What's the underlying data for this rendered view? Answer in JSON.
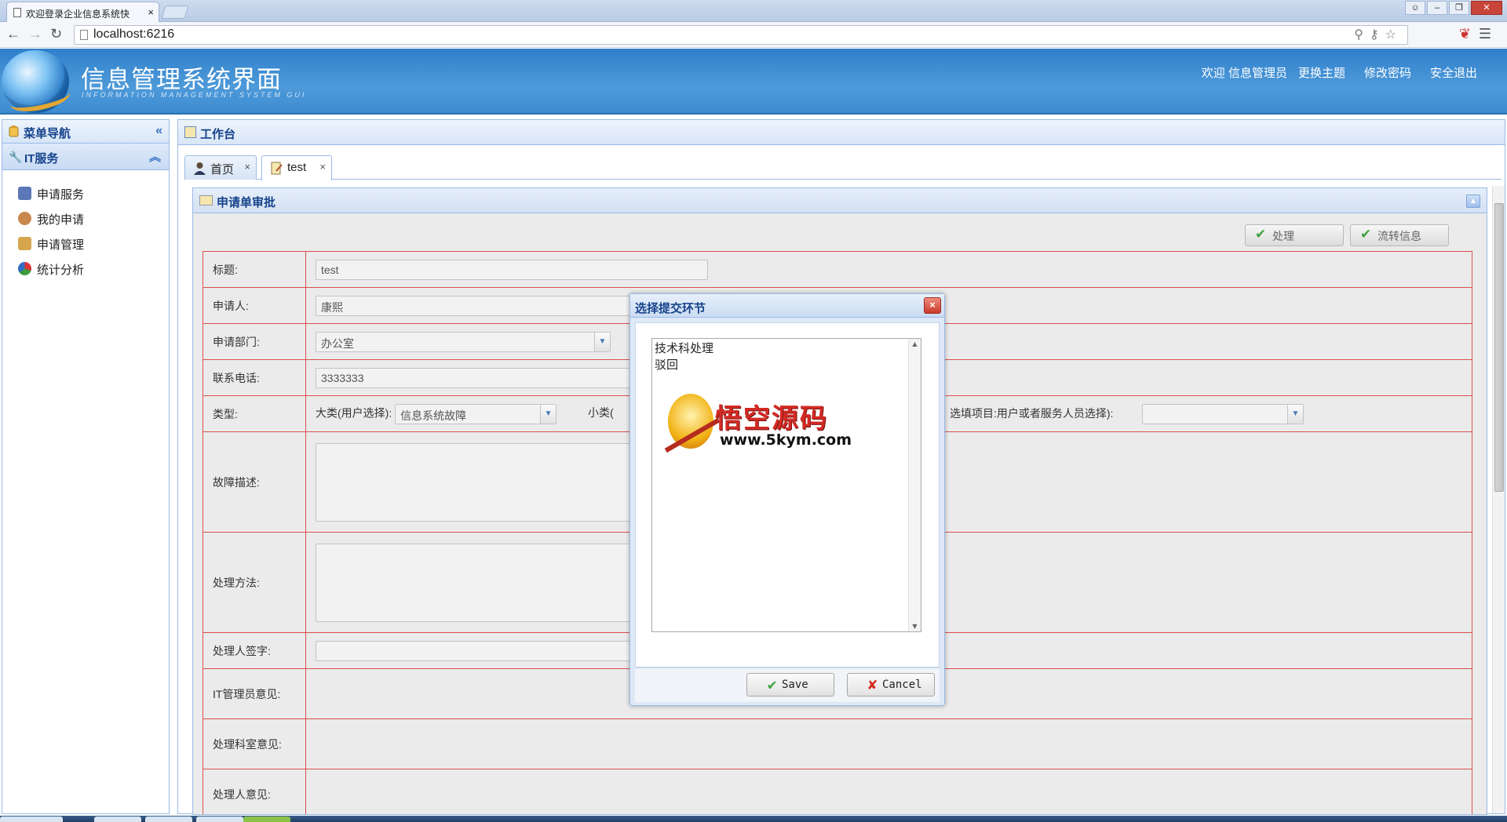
{
  "browser": {
    "tab_title": "欢迎登录企业信息系统快",
    "tab_close": "×",
    "address": "localhost:6216"
  },
  "header": {
    "title": "信息管理系统界面",
    "subtitle": "INFORMATION MANAGEMENT SYSTEM GUI",
    "welcome": "欢迎 信息管理员",
    "change_theme": "更换主题",
    "change_password": "修改密码",
    "logout": "安全退出"
  },
  "sidebar": {
    "title": "菜单导航",
    "collapse": "«",
    "group": "IT服务",
    "group_toggle": "︽",
    "items": [
      {
        "label": "申请服务",
        "icon": "apply-service-icon",
        "color": "#5a78b8"
      },
      {
        "label": "我的申请",
        "icon": "user-icon",
        "color": "#c9874d"
      },
      {
        "label": "申请管理",
        "icon": "manage-icon",
        "color": "#d6a64e"
      },
      {
        "label": "统计分析",
        "icon": "pie-chart-icon",
        "color": "#3c9a3c"
      }
    ]
  },
  "workbench": {
    "title": "工作台",
    "tabs": [
      {
        "label": "首页",
        "close": "×"
      },
      {
        "label": "test",
        "close": "×"
      }
    ]
  },
  "form": {
    "panel_title": "申请单审批",
    "actions": {
      "process": "处理",
      "flow_info": "流转信息"
    },
    "fields": {
      "title_label": "标题:",
      "title_value": "test",
      "applicant_label": "申请人:",
      "applicant_value": "康熙",
      "department_label": "申请部门:",
      "department_value": "办公室",
      "phone_label": "联系电话:",
      "phone_value": "3333333",
      "type_label": "类型:",
      "major_type_label": "大类(用户选择):",
      "major_type_value": "信息系统故障",
      "minor_type_label": "小类(",
      "fill_item_label": "选填项目:用户或者服务人员选择):",
      "fault_desc_label": "故障描述:",
      "method_label": "处理方法:",
      "signer_label": "处理人签字:",
      "it_admin_opinion_label": "IT管理员意见:",
      "section_opinion_label": "处理科室意见:",
      "handler_opinion_label": "处理人意见:"
    }
  },
  "dialog": {
    "title": "选择提交环节",
    "close": "×",
    "options": [
      "技术科处理",
      "驳回"
    ],
    "watermark_cn": "悟空源码",
    "watermark_url": "www.5kym.com",
    "save": "Save",
    "cancel": "Cancel"
  }
}
